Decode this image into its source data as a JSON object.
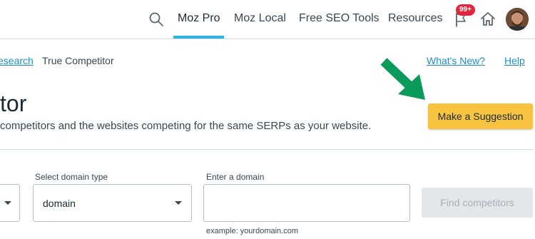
{
  "nav": {
    "items": [
      {
        "label": "Moz Pro",
        "active": true
      },
      {
        "label": "Moz Local",
        "active": false
      },
      {
        "label": "Free SEO Tools",
        "active": false
      },
      {
        "label": "Resources",
        "active": false
      }
    ],
    "notification_badge": "99+",
    "icons": [
      "search-icon",
      "flag-icon",
      "home-icon",
      "avatar"
    ],
    "accent_color": "#2fb5e4"
  },
  "breadcrumb": {
    "parent_link": "esearch",
    "current": "True Competitor"
  },
  "header_links": {
    "whats_new": "What's New?",
    "help": "Help"
  },
  "page": {
    "title": "tor",
    "subtitle": "competitors and the websites competing for the same SERPs as your website."
  },
  "suggestion_button": {
    "label": "Make a Suggestion",
    "color": "#f8c43f"
  },
  "form": {
    "domain_type_label": "Select domain type",
    "domain_type_value": "domain",
    "domain_input_label": "Enter a domain",
    "domain_input_value": "",
    "domain_helper": "example: yourdomain.com",
    "find_button_label": "Find competitors",
    "find_button_disabled": true
  },
  "annotation_arrow_color": "#0a9a5a"
}
